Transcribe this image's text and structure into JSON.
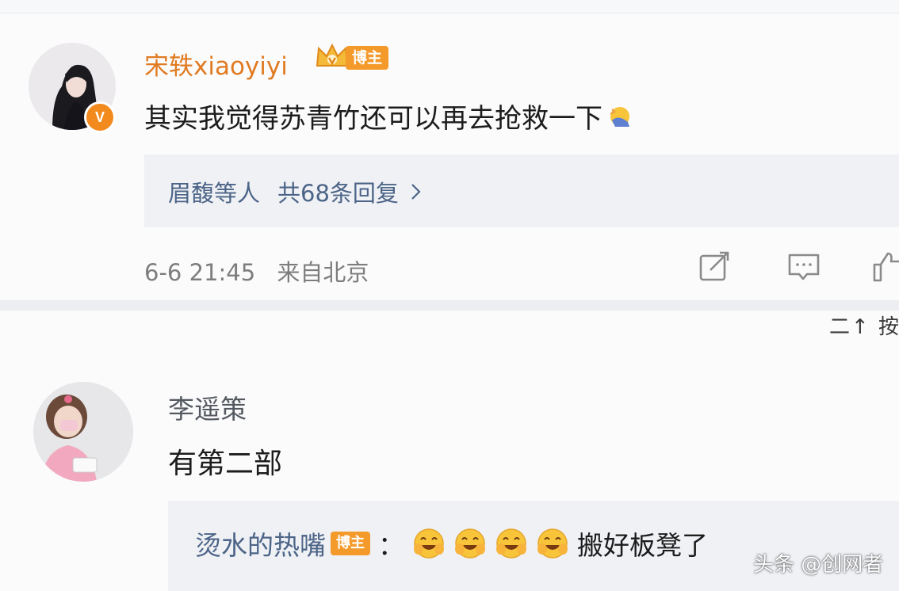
{
  "colors": {
    "username_orange": "#e07b22",
    "blogger_badge": "#f49a2a",
    "link_blue": "#4c6487",
    "text_dark": "#1c1c1c",
    "meta_gray": "#7d7d7d"
  },
  "comment1": {
    "username": "宋轶xiaoyiyi",
    "badge_label": "博主",
    "badge_icon": "crown-icon",
    "verified_icon": "verified-v-icon",
    "verified_label": "V",
    "text": "其实我觉得苏青竹还可以再去抢救一下",
    "emoji": "facepalm-emoji",
    "replies": {
      "who": "眉馥等人",
      "count": "共68条回复"
    },
    "timestamp": "6-6 21:45",
    "location": "来自北京",
    "actions": [
      "share-icon",
      "comment-icon",
      "like-icon"
    ]
  },
  "sort_fragment": "二↑ 按",
  "comment2": {
    "username": "李遥策",
    "text": "有第二部",
    "reply": {
      "username": "烫水的热嘴",
      "badge_label": "博主",
      "colon": "：",
      "text": "搬好板凳了",
      "emoji_count": 4
    }
  },
  "watermark": "头条 @创网者"
}
